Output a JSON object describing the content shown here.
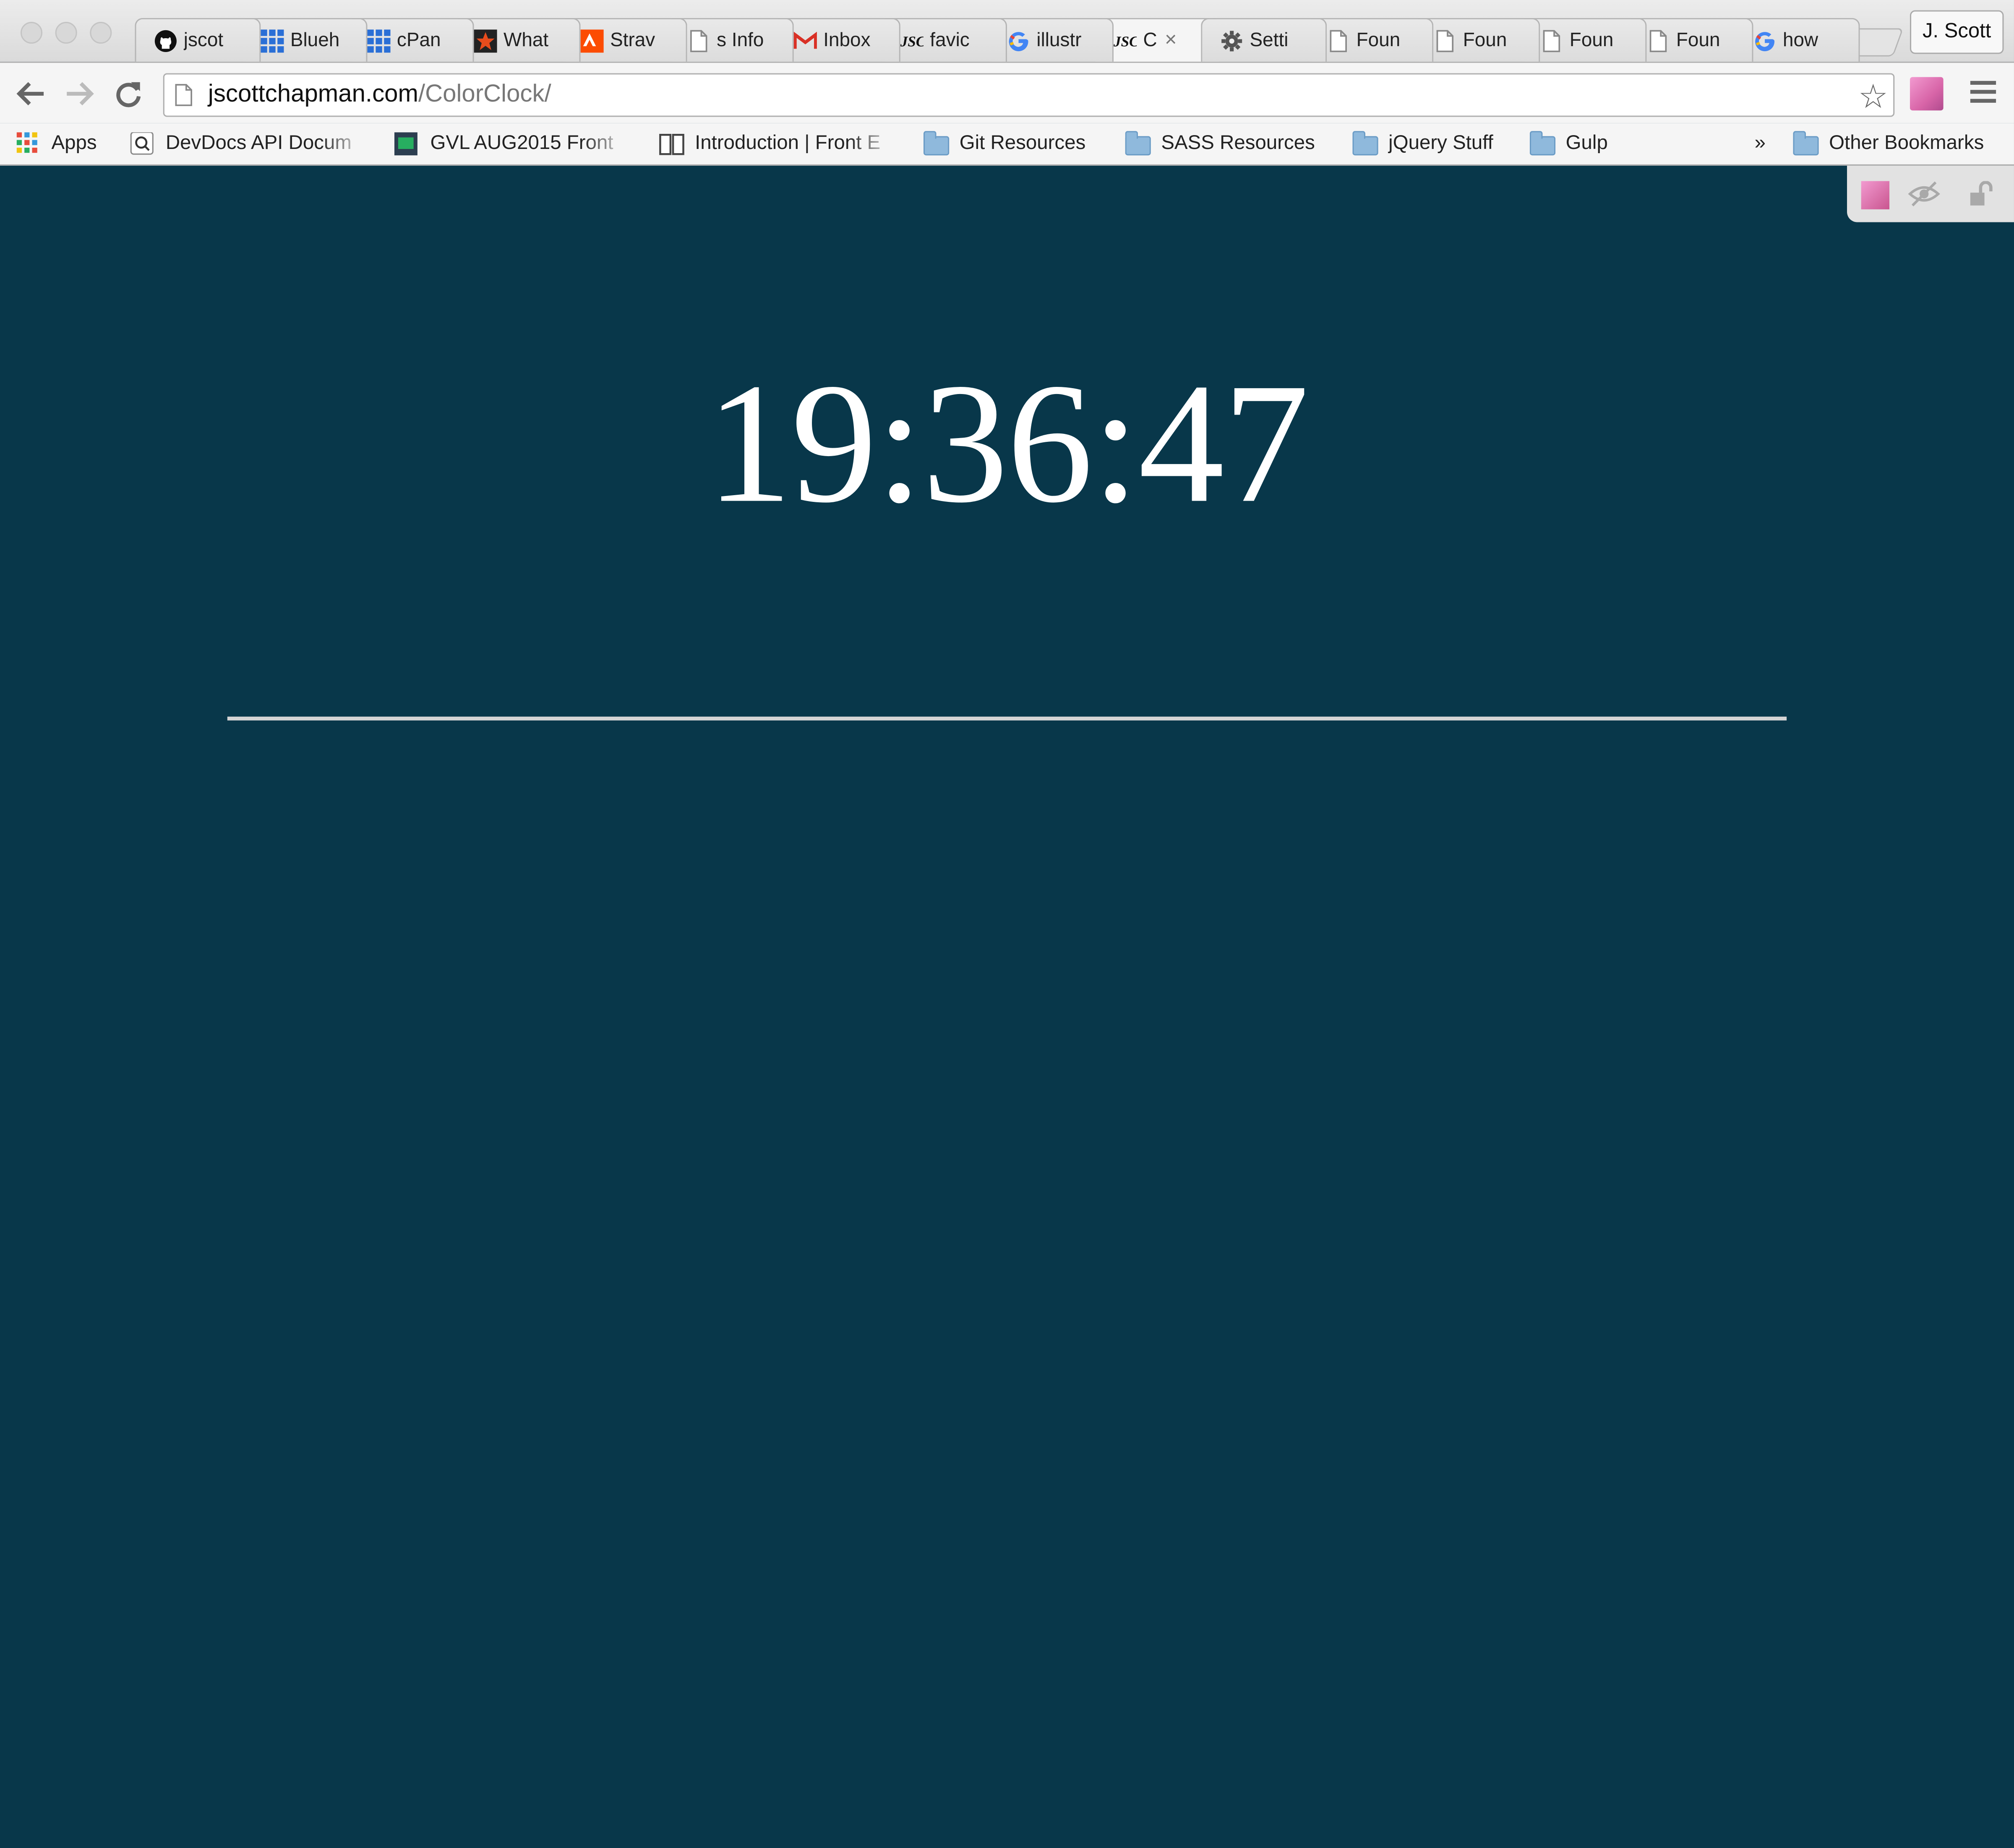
{
  "browser": {
    "tabs": [
      {
        "title": "jscot",
        "icon": "github-icon"
      },
      {
        "title": "Blueh",
        "icon": "grid-icon"
      },
      {
        "title": "cPan",
        "icon": "grid-icon"
      },
      {
        "title": "What",
        "icon": "star-icon"
      },
      {
        "title": "Strav",
        "icon": "strava-icon"
      },
      {
        "title": "s Info",
        "icon": "page-icon"
      },
      {
        "title": "Inbox",
        "icon": "gmail-icon"
      },
      {
        "title": "favic",
        "icon": "jsc-icon"
      },
      {
        "title": "illustr",
        "icon": "google-icon"
      },
      {
        "title": "C",
        "icon": "jsc-icon",
        "active": true
      },
      {
        "title": "Setti",
        "icon": "gear-icon"
      },
      {
        "title": "Foun",
        "icon": "page-icon"
      },
      {
        "title": "Foun",
        "icon": "page-icon"
      },
      {
        "title": "Foun",
        "icon": "page-icon"
      },
      {
        "title": "Foun",
        "icon": "page-icon"
      },
      {
        "title": "how",
        "icon": "google-icon"
      }
    ],
    "profile_name": "J. Scott",
    "url_host": "jscottchapman.com",
    "url_path": "/ColorClock/",
    "bookmarks": {
      "apps": "Apps",
      "devdocs": "DevDocs API Docum",
      "gvl": "GVL AUG2015 Front",
      "intro": "Introduction | Front E",
      "git": "Git Resources",
      "sass": "SASS Resources",
      "jquery": "jQuery Stuff",
      "gulp": "Gulp",
      "more": "»",
      "other": "Other Bookmarks"
    }
  },
  "page": {
    "time": "19:36:47",
    "background_color": "#08374a",
    "text_color": "#ffffff"
  }
}
